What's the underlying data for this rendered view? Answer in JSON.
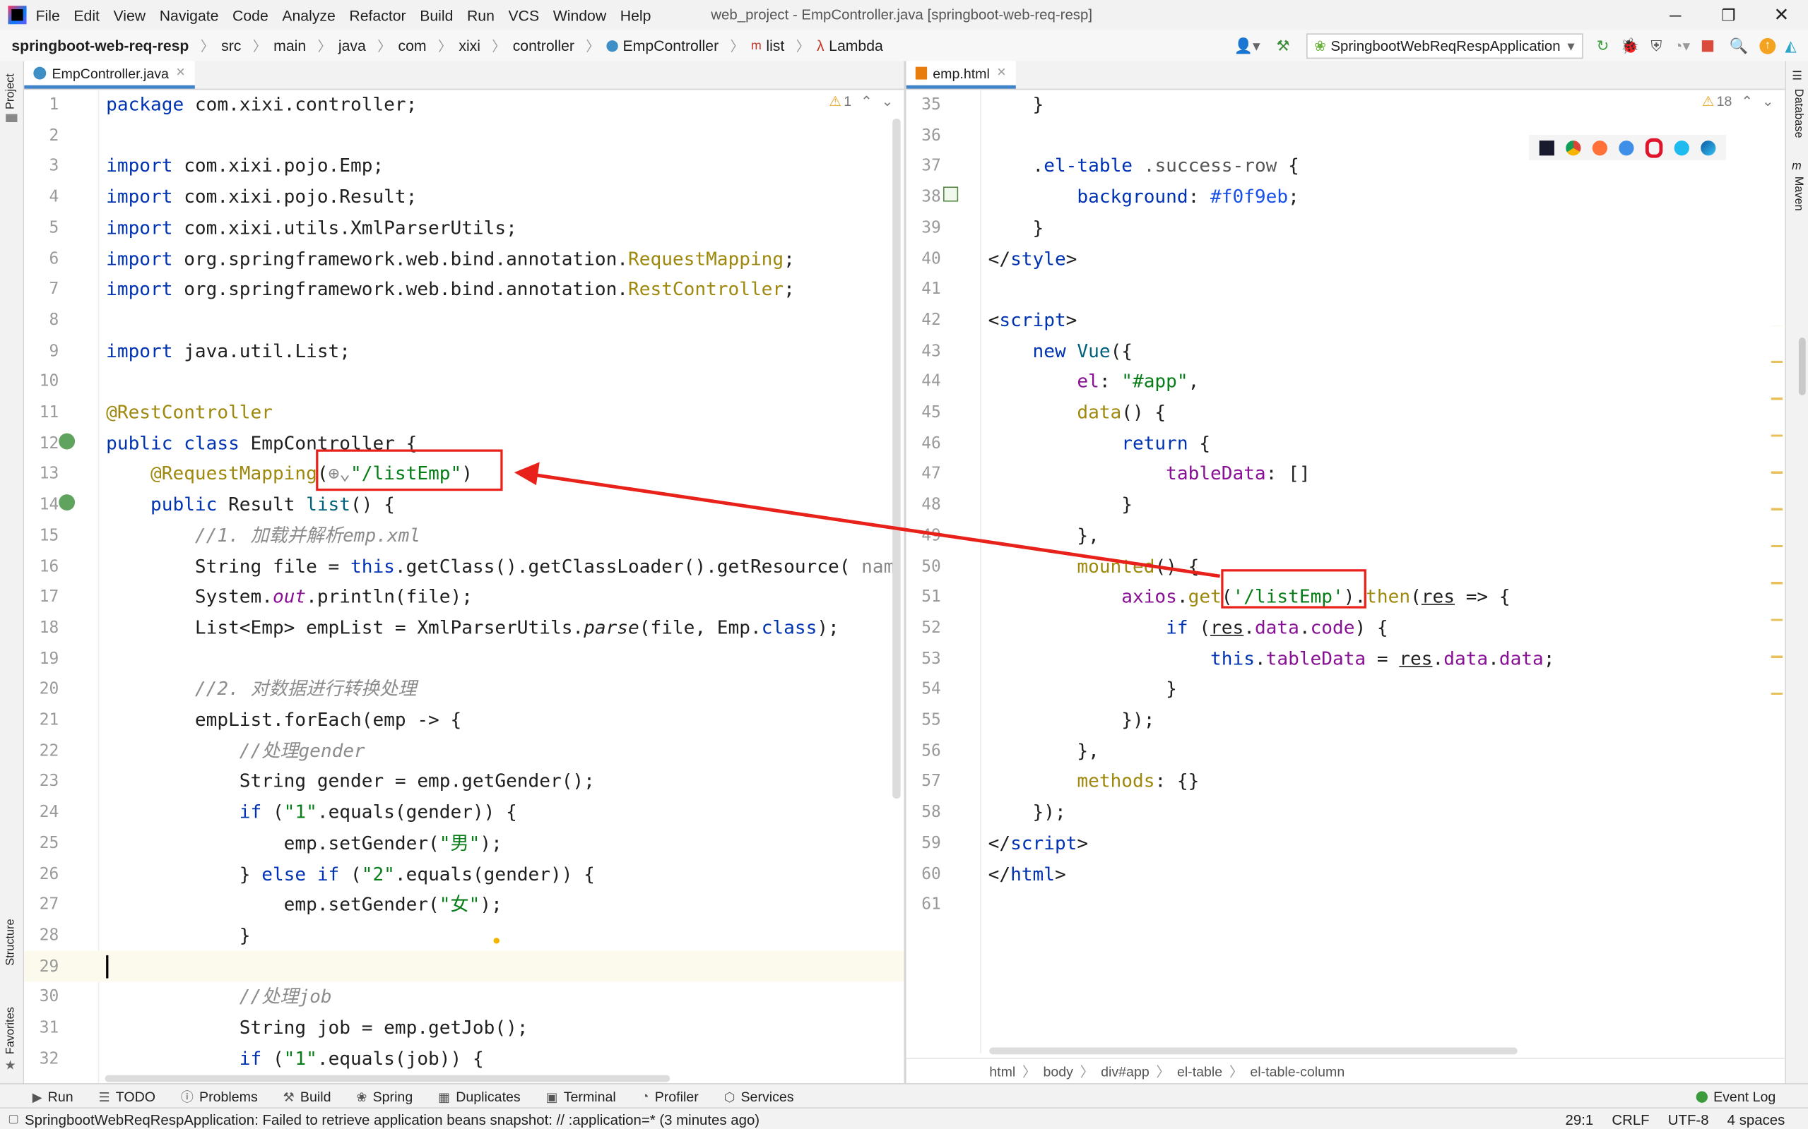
{
  "window": {
    "title": "web_project - EmpController.java [springboot-web-req-resp]",
    "menu": [
      "File",
      "Edit",
      "View",
      "Navigate",
      "Code",
      "Analyze",
      "Refactor",
      "Build",
      "Run",
      "VCS",
      "Window",
      "Help"
    ]
  },
  "breadcrumb": [
    "springboot-web-req-resp",
    "src",
    "main",
    "java",
    "com",
    "xixi",
    "controller",
    "EmpController",
    "list",
    "Lambda"
  ],
  "run_config": "SpringbootWebReqRespApplication",
  "left_tools": [
    "Project",
    "Structure",
    "Favorites"
  ],
  "right_tools": [
    "Database",
    "Maven"
  ],
  "left_editor": {
    "tab": "EmpController.java",
    "warnings": "1",
    "lines": [
      {
        "n": "1",
        "html": "<span class=\"kw\">package</span> com.xixi.controller;"
      },
      {
        "n": "2",
        "html": ""
      },
      {
        "n": "3",
        "html": "<span class=\"kw\">import</span> com.xixi.pojo.Emp;"
      },
      {
        "n": "4",
        "html": "<span class=\"kw\">import</span> com.xixi.pojo.Result;"
      },
      {
        "n": "5",
        "html": "<span class=\"kw\">import</span> com.xixi.utils.XmlParserUtils;"
      },
      {
        "n": "6",
        "html": "<span class=\"kw\">import</span> org.springframework.web.bind.annotation.<span class=\"ann\">RequestMapping</span>;"
      },
      {
        "n": "7",
        "html": "<span class=\"kw\">import</span> org.springframework.web.bind.annotation.<span class=\"ann\">RestController</span>;"
      },
      {
        "n": "8",
        "html": ""
      },
      {
        "n": "9",
        "html": "<span class=\"kw\">import</span> java.util.List;"
      },
      {
        "n": "10",
        "html": ""
      },
      {
        "n": "11",
        "html": "<span class=\"ann\">@RestController</span>"
      },
      {
        "n": "12",
        "html": "<span class=\"kw\">public class</span> EmpController {"
      },
      {
        "n": "13",
        "html": "    <span class=\"ann\">@RequestMapping</span>(<span style=\"color:#888\">⊕⌄</span><span class=\"str\">\"/listEmp\"</span>)"
      },
      {
        "n": "14",
        "html": "    <span class=\"kw\">public</span> Result <span class=\"fn\">list</span>() {"
      },
      {
        "n": "15",
        "html": "        <span class=\"cm\">//1. 加载并解析emp.xml</span>"
      },
      {
        "n": "16",
        "html": "        String file = <span class=\"kw\">this</span>.getClass().getClassLoader().getResource( <span style=\"color:#888\">nam</span>"
      },
      {
        "n": "17",
        "html": "        System.<span class=\"fld it\">out</span>.println(file);"
      },
      {
        "n": "18",
        "html": "        List&lt;Emp&gt; empList = XmlParserUtils.<span class=\"it\">parse</span>(file, Emp.<span class=\"kw\">class</span>);"
      },
      {
        "n": "19",
        "html": ""
      },
      {
        "n": "20",
        "html": "        <span class=\"cm\">//2. 对数据进行转换处理</span>"
      },
      {
        "n": "21",
        "html": "        empList.forEach(emp -&gt; {"
      },
      {
        "n": "22",
        "html": "            <span class=\"cm\">//处理gender</span>"
      },
      {
        "n": "23",
        "html": "            String gender = emp.getGender();"
      },
      {
        "n": "24",
        "html": "            <span class=\"kw\">if</span> (<span class=\"str\">\"1\"</span>.equals(gender)) {"
      },
      {
        "n": "25",
        "html": "                emp.setGender(<span class=\"str\">\"男\"</span>);"
      },
      {
        "n": "26",
        "html": "            } <span class=\"kw\">else if</span> (<span class=\"str\">\"2\"</span>.equals(gender)) {"
      },
      {
        "n": "27",
        "html": "                emp.setGender(<span class=\"str\">\"女\"</span>);"
      },
      {
        "n": "28",
        "html": "            }"
      },
      {
        "n": "29",
        "html": ""
      },
      {
        "n": "30",
        "html": "            <span class=\"cm\">//处理job</span>"
      },
      {
        "n": "31",
        "html": "            String job = emp.getJob();"
      },
      {
        "n": "32",
        "html": "            <span class=\"kw\">if</span> (<span class=\"str\">\"1\"</span>.equals(job)) {"
      }
    ]
  },
  "right_editor": {
    "tab": "emp.html",
    "warnings": "18",
    "lines": [
      {
        "n": "35",
        "html": "    }"
      },
      {
        "n": "36",
        "html": ""
      },
      {
        "n": "37",
        "html": "    .<span class=\"kw\">el-table</span> <span style=\"color:#555\">.success-row</span> {"
      },
      {
        "n": "38",
        "html": "        <span class=\"cssprop\">background</span>: <span class=\"num\">#f0f9eb</span>;"
      },
      {
        "n": "39",
        "html": "    }"
      },
      {
        "n": "40",
        "html": "&lt;/<span class=\"tag\">style</span>&gt;"
      },
      {
        "n": "41",
        "html": ""
      },
      {
        "n": "42",
        "html": "&lt;<span class=\"tag\">script</span>&gt;"
      },
      {
        "n": "43",
        "html": "    <span class=\"kw\">new</span> <span class=\"fn\">Vue</span>({"
      },
      {
        "n": "44",
        "html": "        <span class=\"fld\">el</span>: <span class=\"str\">\"#app\"</span>,"
      },
      {
        "n": "45",
        "html": "        <span class=\"ann\">data</span>() {"
      },
      {
        "n": "46",
        "html": "            <span class=\"kw\">return</span> {"
      },
      {
        "n": "47",
        "html": "                <span class=\"fld\">tableData</span>: []"
      },
      {
        "n": "48",
        "html": "            }"
      },
      {
        "n": "49",
        "html": "        },"
      },
      {
        "n": "50",
        "html": "        <span class=\"ann\">mounted</span>() {"
      },
      {
        "n": "51",
        "html": "            <span class=\"fld\">axios</span>.<span class=\"ann\">get</span>(<span class=\"str\">'/listEmp'</span>).<span class=\"ann\">then</span>(<u>res</u> =&gt; {"
      },
      {
        "n": "52",
        "html": "                <span class=\"kw\">if</span> (<u>res</u>.<span class=\"fld\">data</span>.<span class=\"fld\">code</span>) {"
      },
      {
        "n": "53",
        "html": "                    <span class=\"kw\">this</span>.<span class=\"fld\">tableData</span> = <u>res</u>.<span class=\"fld\">data</span>.<span class=\"fld\">data</span>;"
      },
      {
        "n": "54",
        "html": "                }"
      },
      {
        "n": "55",
        "html": "            });"
      },
      {
        "n": "56",
        "html": "        },"
      },
      {
        "n": "57",
        "html": "        <span class=\"ann\">methods</span>: {}"
      },
      {
        "n": "58",
        "html": "    });"
      },
      {
        "n": "59",
        "html": "&lt;/<span class=\"tag\">script</span>&gt;"
      },
      {
        "n": "60",
        "html": "&lt;/<span class=\"tag\">html</span>&gt;"
      },
      {
        "n": "61",
        "html": ""
      }
    ],
    "breadcrumb": [
      "html",
      "body",
      "div#app",
      "el-table",
      "el-table-column"
    ]
  },
  "bottom_tools": [
    "Run",
    "TODO",
    "Problems",
    "Build",
    "Spring",
    "Duplicates",
    "Terminal",
    "Profiler",
    "Services"
  ],
  "event_log": "Event Log",
  "status": {
    "message": "SpringbootWebReqRespApplication: Failed to retrieve application beans snapshot: // :application=* (3 minutes ago)",
    "position": "29:1",
    "line_sep": "CRLF",
    "encoding": "UTF-8",
    "indent": "4 spaces"
  },
  "colors": {
    "accent": "#4083c9",
    "highlight_box": "#e8221b"
  }
}
